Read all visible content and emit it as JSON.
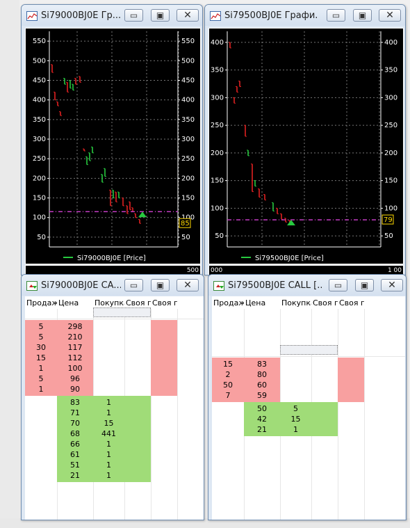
{
  "colors": {
    "sell_bg": "#f8a0a0",
    "buy_bg": "#a0dc78",
    "candle_up": "#27c93f",
    "candle_down": "#e02020",
    "price_line": "#c23cc2"
  },
  "chart_left": {
    "title": "Si79000BJ0E Гр...",
    "legend": "Si79000BJ0E [Price]",
    "y_ticks": [
      "550",
      "500",
      "450",
      "400",
      "350",
      "300",
      "250",
      "200",
      "150",
      "100",
      "50"
    ],
    "current_price": "85",
    "bottom_tick": "500"
  },
  "chart_right": {
    "title": "Si79500BJ0E Графи...",
    "legend": "Si79500BJ0E [Price]",
    "y_ticks": [
      "400",
      "350",
      "300",
      "250",
      "200",
      "150",
      "100",
      "50"
    ],
    "current_price": "79",
    "bottom_left_tick": "000",
    "bottom_right_tick": "1 00"
  },
  "book_left": {
    "title": "Si79000BJ0E CA...",
    "headers": [
      "Продаж",
      "Цена",
      "Покупка",
      "Своя п",
      "Своя п"
    ],
    "sell_rows": [
      {
        "qty": "5",
        "price": "298"
      },
      {
        "qty": "5",
        "price": "210"
      },
      {
        "qty": "30",
        "price": "117"
      },
      {
        "qty": "15",
        "price": "112"
      },
      {
        "qty": "1",
        "price": "100"
      },
      {
        "qty": "5",
        "price": "96"
      },
      {
        "qty": "1",
        "price": "90"
      }
    ],
    "buy_rows": [
      {
        "price": "83",
        "qty": "1"
      },
      {
        "price": "71",
        "qty": "1"
      },
      {
        "price": "70",
        "qty": "15"
      },
      {
        "price": "68",
        "qty": "441"
      },
      {
        "price": "66",
        "qty": "1"
      },
      {
        "price": "61",
        "qty": "1"
      },
      {
        "price": "51",
        "qty": "1"
      },
      {
        "price": "21",
        "qty": "1"
      }
    ]
  },
  "book_right": {
    "title": "Si79500BJ0E CALL [...",
    "headers": [
      "Продаж",
      "Цена",
      "Покупка",
      "Своя п",
      "Своя п"
    ],
    "sell_rows": [
      {
        "qty": "15",
        "price": "83"
      },
      {
        "qty": "2",
        "price": "80"
      },
      {
        "qty": "50",
        "price": "60"
      },
      {
        "qty": "7",
        "price": "59"
      }
    ],
    "buy_rows": [
      {
        "price": "50",
        "qty": "5"
      },
      {
        "price": "42",
        "qty": "15"
      },
      {
        "price": "21",
        "qty": "1"
      }
    ]
  },
  "window_buttons": {
    "minimize": "▭",
    "maximize": "▣",
    "close": "✕"
  }
}
